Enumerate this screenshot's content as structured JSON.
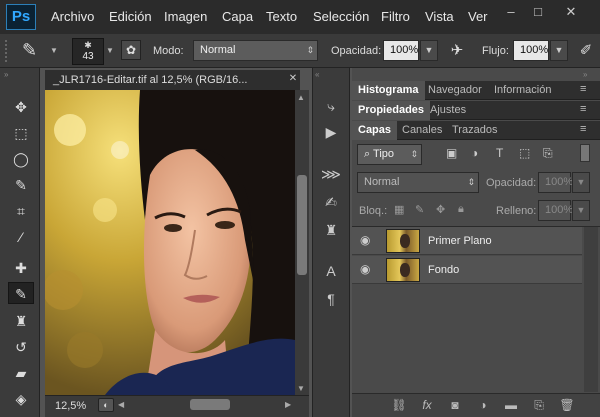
{
  "menu": {
    "logo": "Ps",
    "items": [
      "Archivo",
      "Edición",
      "Imagen",
      "Capa",
      "Texto",
      "Selección",
      "Filtro",
      "Vista",
      "Ver"
    ]
  },
  "window_buttons": {
    "minimize": "–",
    "maximize": "□",
    "close": "✕"
  },
  "options": {
    "brush_size": "43",
    "mode_label": "Modo:",
    "mode_value": "Normal",
    "opacity_label": "Opacidad:",
    "opacity_value": "100%",
    "flow_label": "Flujo:",
    "flow_value": "100%"
  },
  "document": {
    "tab_title": "_JLR1716-Editar.tif al 12,5% (RGB/16...",
    "zoom": "12,5%"
  },
  "panels": {
    "top_tabs": [
      "Histograma",
      "Navegador",
      "Información"
    ],
    "mid_tabs": [
      "Propiedades",
      "Ajustes"
    ],
    "layer_tabs": [
      "Capas",
      "Canales",
      "Trazados"
    ],
    "filter_kind": "Tipo",
    "blend_mode": "Normal",
    "opacity_label": "Opacidad:",
    "opacity_value": "100%",
    "lock_label": "Bloq.:",
    "fill_label": "Relleno:",
    "fill_value": "100%"
  },
  "layers": [
    {
      "name": "Primer Plano"
    },
    {
      "name": "Fondo"
    }
  ],
  "colors": {
    "menubar_bg": "#2b2b2b",
    "panel_bg": "#535353",
    "accent_blue": "#31a8ff"
  }
}
